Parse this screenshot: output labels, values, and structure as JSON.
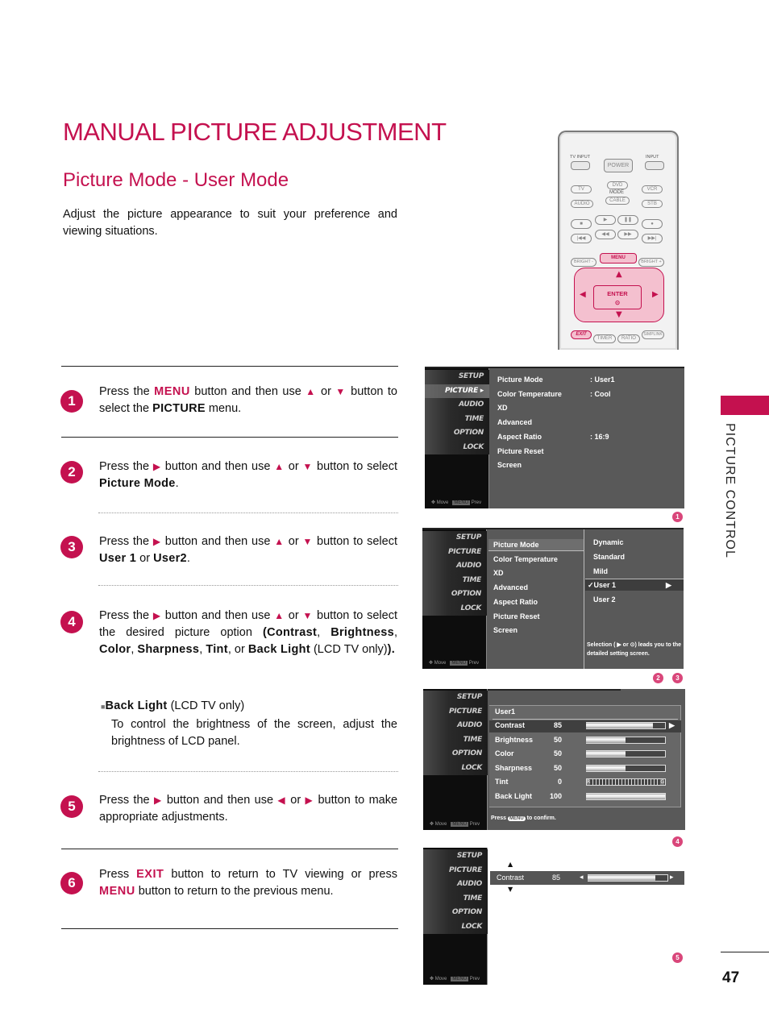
{
  "page": {
    "title": "MANUAL PICTURE ADJUSTMENT",
    "subtitle": "Picture Mode - User Mode",
    "intro": "Adjust the picture appearance to suit your preference and viewing situations.",
    "side_label": "PICTURE CONTROL",
    "page_number": "47",
    "accent_color": "#c4114f"
  },
  "remote": {
    "tv_input": "TV INPUT",
    "input": "INPUT",
    "power": "POWER",
    "tv": "TV",
    "dvd": "DVD",
    "vcr": "VCR",
    "mode": "MODE",
    "audio": "AUDIO",
    "cable": "CABLE",
    "stb": "STB",
    "transport": [
      "■",
      "▶",
      "❚❚",
      "●"
    ],
    "transport2": [
      "|◀◀",
      "◀◀",
      "▶▶",
      "▶▶|"
    ],
    "bright_minus": "BRIGHT -",
    "menu": "MENU",
    "bright_plus": "BRIGHT +",
    "enter": "ENTER",
    "exit": "EXIT",
    "timer": "TIMER",
    "ratio": "RATIO",
    "simplink": "SIMPLINK"
  },
  "steps": [
    {
      "num": "1",
      "parts": {
        "a": "Press the ",
        "menu": "MENU",
        "b": " button and then use ",
        "up": "▲",
        "or": " or ",
        "down": "▼",
        "c": " button to select the ",
        "picture": "PICTURE",
        "d": " menu."
      }
    },
    {
      "num": "2",
      "parts": {
        "a": "Press the ",
        "right": "▶",
        "b": " button and then use ",
        "up": "▲",
        "or": " or ",
        "down": "▼",
        "c": " button to select ",
        "target": "Picture Mode",
        "d": "."
      }
    },
    {
      "num": "3",
      "parts": {
        "a": "Press the ",
        "right": "▶",
        "b": " button and then use ",
        "up": "▲",
        "or": " or ",
        "down": "▼",
        "c": " button to select ",
        "u1": "User 1",
        "or2": " or ",
        "u2": "User2",
        "d": "."
      }
    },
    {
      "num": "4",
      "parts": {
        "a": "Press the ",
        "right": "▶",
        "b": " button and then use ",
        "up": "▲",
        "or": " or ",
        "down": "▼",
        "c": " button to select the desired picture option ",
        "o1": "(Contrast",
        "s1": ", ",
        "o2": "Brightness",
        "s2": ", ",
        "o3": "Color",
        "s3": ", ",
        "o4": "Sharpness",
        "s4": ", ",
        "o5": "Tint",
        "s5": ", or ",
        "o6": "Back Light",
        "d": " (LCD TV only)",
        "e": ")."
      }
    },
    {
      "num": "5",
      "parts": {
        "a": "Press the ",
        "right": "▶",
        "b": " button and then use ",
        "left": "◀",
        "or": " or ",
        "right2": "▶",
        "c": " button to make appropriate adjustments."
      }
    },
    {
      "num": "6",
      "parts": {
        "a": "Press ",
        "exit": "EXIT",
        "b": " button to return to TV viewing or press ",
        "menu": "MENU",
        "c": " button to return to the previous menu."
      }
    }
  ],
  "note": {
    "bullet": "■",
    "title": "Back Light",
    "title_suffix": " (LCD TV only)",
    "body": "To control the brightness of the screen, adjust the brightness of LCD panel."
  },
  "osd_menu": [
    "SETUP",
    "PICTURE",
    "AUDIO",
    "TIME",
    "OPTION",
    "LOCK"
  ],
  "osd_footer": {
    "move": "Move",
    "prev": "Prev",
    "menu_key": "MENU"
  },
  "screen1": {
    "marker": "1",
    "rows": [
      {
        "label": "Picture Mode",
        "value": ": User1"
      },
      {
        "label": "Color Temperature",
        "value": ": Cool"
      },
      {
        "label": "XD",
        "value": ""
      },
      {
        "label": "Advanced",
        "value": ""
      },
      {
        "label": "Aspect Ratio",
        "value": ": 16:9"
      },
      {
        "label": "Picture Reset",
        "value": ""
      },
      {
        "label": "Screen",
        "value": ""
      }
    ]
  },
  "screen2": {
    "markers": [
      "2",
      "3"
    ],
    "rows": [
      "Picture Mode",
      "Color Temperature",
      "XD",
      "Advanced",
      "Aspect Ratio",
      "Picture Reset",
      "Screen"
    ],
    "options": [
      "Dynamic",
      "Standard",
      "Mild",
      "User 1",
      "User 2"
    ],
    "selected_option": "User 1",
    "check": "✓",
    "hint": "Selection ( ▶ or ⊙) leads you  to the detailed setting screen."
  },
  "screen3": {
    "marker": "4",
    "header": "User1",
    "settings": [
      {
        "label": "Contrast",
        "value": "85",
        "level": 0.85
      },
      {
        "label": "Brightness",
        "value": "50",
        "level": 0.5
      },
      {
        "label": "Color",
        "value": "50",
        "level": 0.5
      },
      {
        "label": "Sharpness",
        "value": "50",
        "level": 0.5
      },
      {
        "label": "Tint",
        "value": "0",
        "level": 0.5,
        "tint": true,
        "left": "R",
        "right": "G"
      },
      {
        "label": "Back Light",
        "value": "100",
        "level": 1.0
      }
    ],
    "confirm_press": "Press",
    "confirm_key": "MENU",
    "confirm_rest": "to confirm."
  },
  "screen4": {
    "marker": "5",
    "label": "Contrast",
    "value": "85",
    "level": 0.85,
    "up": "▲",
    "down": "▼"
  }
}
